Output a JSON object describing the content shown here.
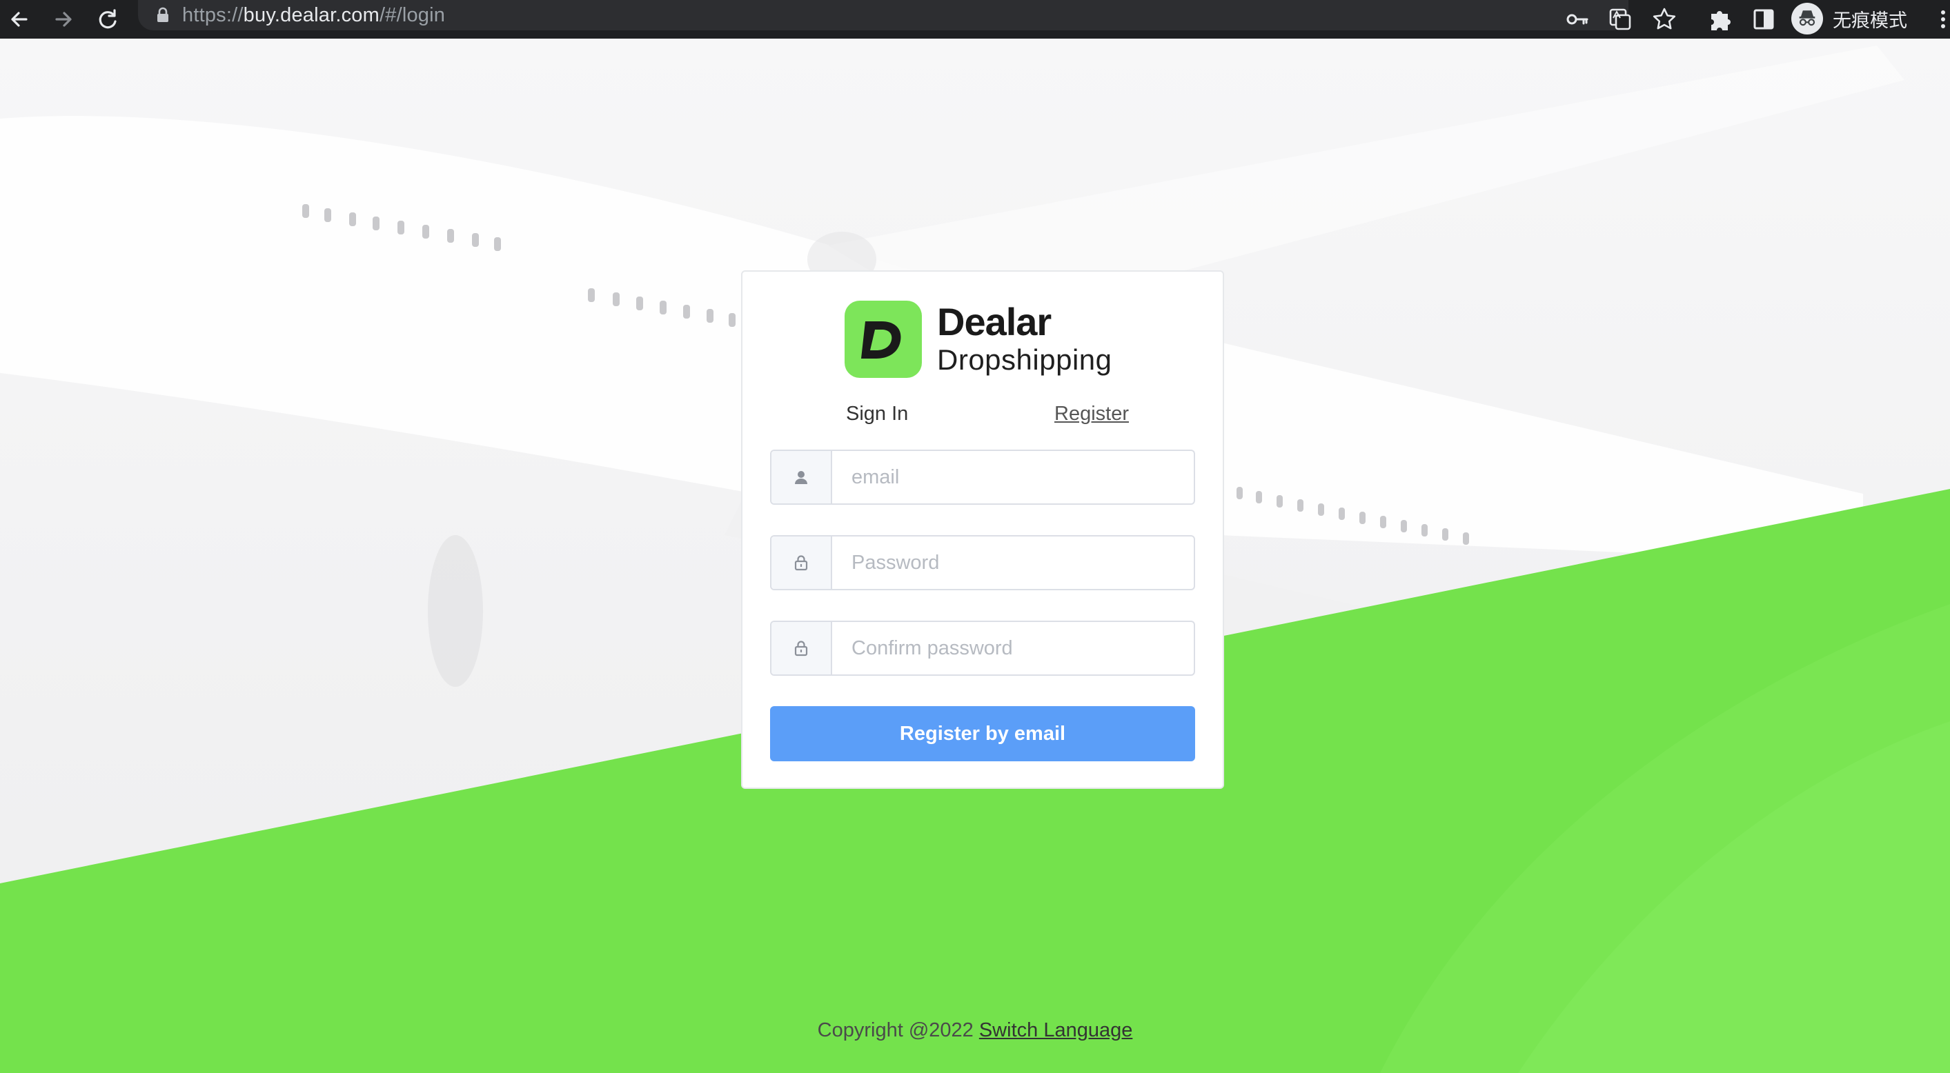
{
  "browser": {
    "url_scheme": "https://",
    "url_host": "buy.dealar.com",
    "url_path": "/#/login",
    "incognito_label": "无痕模式"
  },
  "icons": {
    "back": "arrow-left-icon",
    "forward": "arrow-right-icon",
    "reload": "reload-icon",
    "lock": "lock-icon",
    "key": "key-icon",
    "translate": "translate-icon",
    "star": "star-icon",
    "extensions": "puzzle-icon",
    "sidepanel": "side-panel-icon",
    "incognito": "incognito-icon",
    "menu": "kebab-menu-icon"
  },
  "brand": {
    "name": "Dealar",
    "subtitle": "Dropshipping",
    "mark_letter": "D",
    "accent_color": "#7de55a"
  },
  "tabs": {
    "signin": "Sign In",
    "register": "Register"
  },
  "form": {
    "email_placeholder": "email",
    "password_placeholder": "Password",
    "confirm_placeholder": "Confirm password",
    "submit_label": "Register by email",
    "submit_color": "#5b9ef8"
  },
  "footer": {
    "copyright": "Copyright @2022",
    "switch_language": "Switch Language"
  },
  "colors": {
    "green_band": "#74e24c",
    "chrome_bg": "#1f2022"
  }
}
